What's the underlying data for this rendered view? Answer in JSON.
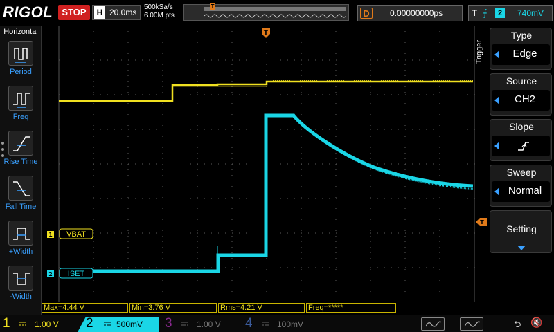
{
  "topbar": {
    "logo": "RIGOL",
    "run_status": "STOP",
    "timebase_key": "H",
    "timebase_value": "20.0ms",
    "sample_rate": "500kSa/s",
    "memory_depth": "6.00M pts",
    "delay_key": "D",
    "delay_value": "0.00000000ps",
    "trigger_key": "T",
    "trigger_channel": "2",
    "trigger_level": "740mV"
  },
  "left_menu": {
    "title": "Horizontal",
    "items": [
      {
        "label": "Period",
        "icon": "period-icon"
      },
      {
        "label": "Freq",
        "icon": "freq-icon"
      },
      {
        "label": "Rise Time",
        "icon": "rise-time-icon"
      },
      {
        "label": "Fall Time",
        "icon": "fall-time-icon"
      },
      {
        "label": "+Width",
        "icon": "pos-width-icon"
      },
      {
        "label": "-Width",
        "icon": "neg-width-icon"
      }
    ]
  },
  "right_menu": {
    "vertical_title": "Trigger",
    "items": [
      {
        "title": "Type",
        "value": "Edge"
      },
      {
        "title": "Source",
        "value": "CH2"
      },
      {
        "title": "Slope",
        "value": ""
      },
      {
        "title": "Sweep",
        "value": "Normal"
      },
      {
        "title": "Setting",
        "value": ""
      }
    ]
  },
  "channels_labels": {
    "ch1": {
      "marker": "1",
      "tag": "VBAT"
    },
    "ch2": {
      "marker": "2",
      "tag": "ISET"
    },
    "trigger_level_marker": "T",
    "trigger_pos_marker": "T"
  },
  "measurements": [
    {
      "text": "Max=4.44 V"
    },
    {
      "text": "Min=3.76 V"
    },
    {
      "text": "Rms=4.21 V"
    },
    {
      "text": "Freq=*****"
    }
  ],
  "channel_bar": [
    {
      "num": "1",
      "scale": "1.00 V",
      "color": "#f0e020",
      "state": "on"
    },
    {
      "num": "2",
      "scale": "500mV",
      "color": "#1ad6e6",
      "state": "active"
    },
    {
      "num": "3",
      "scale": "1.00 V",
      "color": "#c02ad0",
      "state": "off"
    },
    {
      "num": "4",
      "scale": "100mV",
      "color": "#3a6ad0",
      "state": "off"
    }
  ],
  "colors": {
    "ch1": "#f0e020",
    "ch2": "#1ad6e6",
    "trigger": "#e07a1a",
    "accent": "#3aa0ff",
    "grid": "#5a5a5a"
  }
}
